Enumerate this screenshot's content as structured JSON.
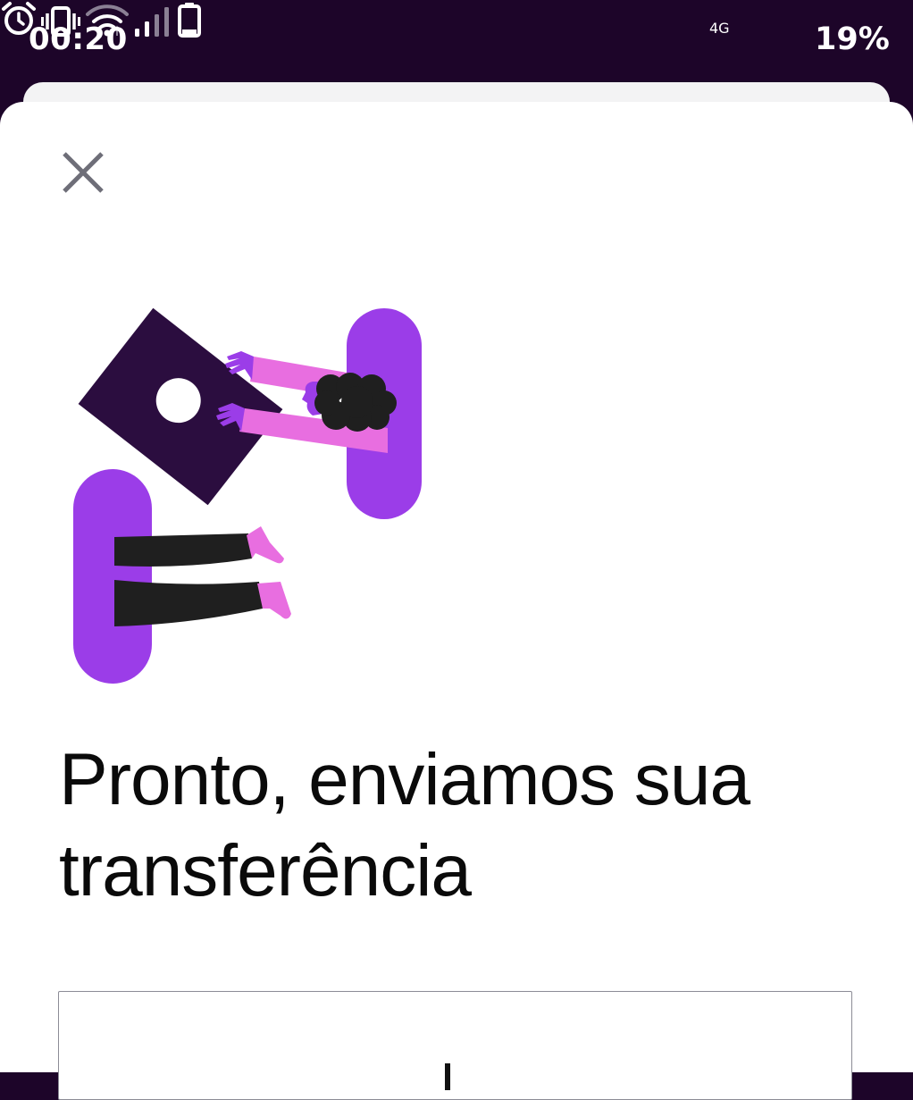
{
  "status_bar": {
    "time": "00:20",
    "network_label": "4G",
    "battery": "19%",
    "icons": [
      "alarm-icon",
      "vibrate-icon",
      "wifi-icon",
      "cell-signal-icon",
      "battery-icon"
    ]
  },
  "sheet": {
    "close_icon": "close-icon",
    "headline": "Pronto, enviamos sua transferência"
  },
  "colors": {
    "status_bar_bg": "#1d0529",
    "purple": "#9b3de8",
    "pink": "#e86ee0",
    "dark_purple": "#2b0d3f",
    "hair": "#1f1f1f",
    "close_icon": "#6e6e78"
  }
}
